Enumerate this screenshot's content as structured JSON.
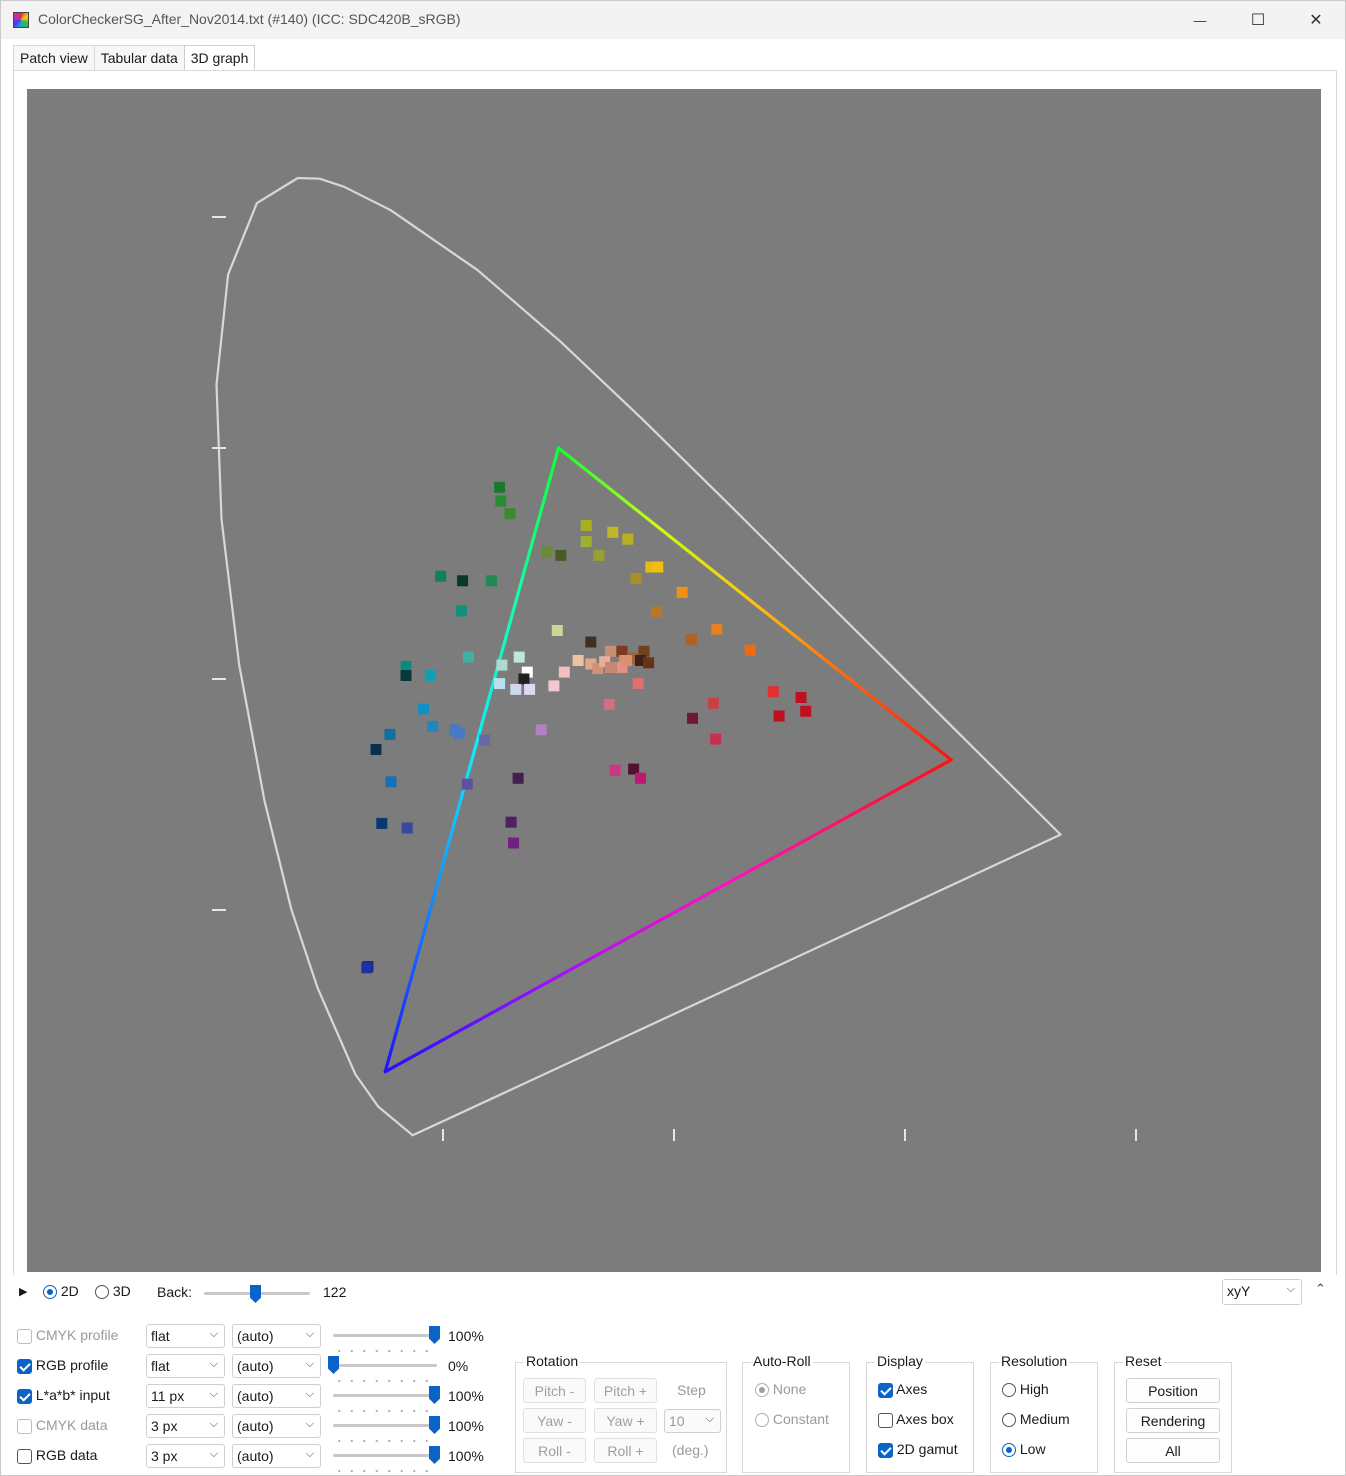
{
  "window": {
    "title": "ColorCheckerSG_After_Nov2014.txt (#140) (ICC: SDC420B_sRGB)",
    "minimize": "—",
    "maximize": "☐",
    "close": "✕"
  },
  "tabs": [
    {
      "label": "Patch view",
      "active": false
    },
    {
      "label": "Tabular data",
      "active": false
    },
    {
      "label": "3D graph",
      "active": true
    }
  ],
  "view": {
    "mode_2d": "2D",
    "mode_3d": "3D",
    "selected_mode": "2D",
    "back_label": "Back:",
    "back_value": "122",
    "back_level": 0.48,
    "colorspace": "xyY",
    "expand_icon": "double-chevron-up-icon"
  },
  "layers": [
    {
      "label": "CMYK profile",
      "checked": false,
      "enabled": false,
      "style": "flat",
      "color": "(auto)",
      "opacity_pct": "100%",
      "opacity": 1.0
    },
    {
      "label": "RGB profile",
      "checked": true,
      "enabled": true,
      "style": "flat",
      "color": "(auto)",
      "opacity_pct": "0%",
      "opacity": 0.0
    },
    {
      "label": "L*a*b* input",
      "checked": true,
      "enabled": true,
      "style": "11 px",
      "color": "(auto)",
      "opacity_pct": "100%",
      "opacity": 1.0
    },
    {
      "label": "CMYK data",
      "checked": false,
      "enabled": false,
      "style": "3 px",
      "color": "(auto)",
      "opacity_pct": "100%",
      "opacity": 1.0
    },
    {
      "label": "RGB data",
      "checked": false,
      "enabled": true,
      "style": "3 px",
      "color": "(auto)",
      "opacity_pct": "100%",
      "opacity": 1.0
    }
  ],
  "rotation": {
    "title": "Rotation",
    "pitch_minus": "Pitch -",
    "pitch_plus": "Pitch +",
    "yaw_minus": "Yaw -",
    "yaw_plus": "Yaw +",
    "roll_minus": "Roll -",
    "roll_plus": "Roll +",
    "step_label": "Step",
    "step_value": "10",
    "unit": "(deg.)"
  },
  "auto_roll": {
    "title": "Auto-Roll",
    "options": [
      "None",
      "Constant"
    ],
    "selected": "None"
  },
  "display": {
    "title": "Display",
    "axes": {
      "label": "Axes",
      "checked": true
    },
    "axes_box": {
      "label": "Axes box",
      "checked": false
    },
    "gamut_2d": {
      "label": "2D gamut",
      "checked": true
    }
  },
  "resolution": {
    "title": "Resolution",
    "options": [
      "High",
      "Medium",
      "Low"
    ],
    "selected": "Low"
  },
  "reset": {
    "title": "Reset",
    "position": "Position",
    "rendering": "Rendering",
    "all": "All"
  },
  "chart_data": {
    "type": "scatter",
    "colorspace": "xyY",
    "x_axis_color": "#d01010",
    "y_axis_color": "#20c020",
    "xlim": [
      0,
      0.8
    ],
    "ylim": [
      0,
      0.8
    ],
    "x_ticks": [
      0.2,
      0.4,
      0.6,
      0.8
    ],
    "y_ticks": [
      0.2,
      0.4,
      0.6,
      0.8
    ],
    "spectral_locus": [
      [
        0.1738,
        0.0049
      ],
      [
        0.144,
        0.0297
      ],
      [
        0.1241,
        0.0578
      ],
      [
        0.0913,
        0.1327
      ],
      [
        0.0687,
        0.2007
      ],
      [
        0.0454,
        0.295
      ],
      [
        0.0235,
        0.4127
      ],
      [
        0.0082,
        0.5384
      ],
      [
        0.0039,
        0.6548
      ],
      [
        0.0139,
        0.7502
      ],
      [
        0.0389,
        0.812
      ],
      [
        0.0743,
        0.8338
      ],
      [
        0.0932,
        0.8332
      ],
      [
        0.1142,
        0.8262
      ],
      [
        0.1547,
        0.8059
      ],
      [
        0.2296,
        0.7543
      ],
      [
        0.3016,
        0.6923
      ],
      [
        0.3731,
        0.6245
      ],
      [
        0.4441,
        0.5547
      ],
      [
        0.5125,
        0.4866
      ],
      [
        0.5752,
        0.4242
      ],
      [
        0.627,
        0.3725
      ],
      [
        0.6915,
        0.3083
      ],
      [
        0.7347,
        0.2653
      ]
    ],
    "srgb_gamut": {
      "red": [
        0.64,
        0.33
      ],
      "green": [
        0.3,
        0.6
      ],
      "blue": [
        0.15,
        0.06
      ]
    },
    "patches": [
      {
        "x": 0.249,
        "y": 0.566,
        "c": "#1a7a2a"
      },
      {
        "x": 0.25,
        "y": 0.554,
        "c": "#2a8a30"
      },
      {
        "x": 0.258,
        "y": 0.543,
        "c": "#3a8a30"
      },
      {
        "x": 0.324,
        "y": 0.533,
        "c": "#a8b020"
      },
      {
        "x": 0.324,
        "y": 0.519,
        "c": "#a0b030"
      },
      {
        "x": 0.347,
        "y": 0.527,
        "c": "#c0b828"
      },
      {
        "x": 0.36,
        "y": 0.521,
        "c": "#b8b020"
      },
      {
        "x": 0.335,
        "y": 0.507,
        "c": "#98a030"
      },
      {
        "x": 0.29,
        "y": 0.51,
        "c": "#6a8a38"
      },
      {
        "x": 0.302,
        "y": 0.507,
        "c": "#4a5a28"
      },
      {
        "x": 0.38,
        "y": 0.497,
        "c": "#e8b818"
      },
      {
        "x": 0.386,
        "y": 0.497,
        "c": "#f0c010"
      },
      {
        "x": 0.367,
        "y": 0.487,
        "c": "#a89028"
      },
      {
        "x": 0.407,
        "y": 0.475,
        "c": "#f09018"
      },
      {
        "x": 0.385,
        "y": 0.458,
        "c": "#b87828"
      },
      {
        "x": 0.437,
        "y": 0.443,
        "c": "#e88020"
      },
      {
        "x": 0.466,
        "y": 0.425,
        "c": "#f06a10"
      },
      {
        "x": 0.415,
        "y": 0.434,
        "c": "#b06020"
      },
      {
        "x": 0.198,
        "y": 0.489,
        "c": "#108060"
      },
      {
        "x": 0.217,
        "y": 0.485,
        "c": "#083828"
      },
      {
        "x": 0.242,
        "y": 0.485,
        "c": "#208a50"
      },
      {
        "x": 0.216,
        "y": 0.459,
        "c": "#10907a"
      },
      {
        "x": 0.222,
        "y": 0.419,
        "c": "#40b0a0"
      },
      {
        "x": 0.168,
        "y": 0.411,
        "c": "#108880"
      },
      {
        "x": 0.168,
        "y": 0.403,
        "c": "#083838"
      },
      {
        "x": 0.189,
        "y": 0.403,
        "c": "#10a0b0"
      },
      {
        "x": 0.251,
        "y": 0.412,
        "c": "#b0d8d0"
      },
      {
        "x": 0.266,
        "y": 0.419,
        "c": "#c0e8d8"
      },
      {
        "x": 0.299,
        "y": 0.442,
        "c": "#c8d898"
      },
      {
        "x": 0.328,
        "y": 0.432,
        "c": "#403020"
      },
      {
        "x": 0.345,
        "y": 0.424,
        "c": "#c89070"
      },
      {
        "x": 0.355,
        "y": 0.424,
        "c": "#803820"
      },
      {
        "x": 0.357,
        "y": 0.416,
        "c": "#c89070"
      },
      {
        "x": 0.365,
        "y": 0.418,
        "c": "#a06030"
      },
      {
        "x": 0.374,
        "y": 0.424,
        "c": "#704020"
      },
      {
        "x": 0.371,
        "y": 0.416,
        "c": "#402018"
      },
      {
        "x": 0.378,
        "y": 0.414,
        "c": "#6a3018"
      },
      {
        "x": 0.317,
        "y": 0.416,
        "c": "#f0c0a0"
      },
      {
        "x": 0.328,
        "y": 0.413,
        "c": "#e0a888"
      },
      {
        "x": 0.334,
        "y": 0.409,
        "c": "#d09078"
      },
      {
        "x": 0.34,
        "y": 0.415,
        "c": "#e8b098"
      },
      {
        "x": 0.345,
        "y": 0.41,
        "c": "#c88870"
      },
      {
        "x": 0.355,
        "y": 0.41,
        "c": "#e89080"
      },
      {
        "x": 0.359,
        "y": 0.416,
        "c": "#d89070"
      },
      {
        "x": 0.273,
        "y": 0.406,
        "c": "#ffffff"
      },
      {
        "x": 0.27,
        "y": 0.4,
        "c": "#202020"
      },
      {
        "x": 0.305,
        "y": 0.406,
        "c": "#f0c0c0"
      },
      {
        "x": 0.296,
        "y": 0.394,
        "c": "#f0c8d0"
      },
      {
        "x": 0.249,
        "y": 0.396,
        "c": "#b8e0f0"
      },
      {
        "x": 0.263,
        "y": 0.391,
        "c": "#d0d8f0"
      },
      {
        "x": 0.275,
        "y": 0.391,
        "c": "#e0d8f0"
      },
      {
        "x": 0.369,
        "y": 0.396,
        "c": "#e07070"
      },
      {
        "x": 0.344,
        "y": 0.378,
        "c": "#d07080"
      },
      {
        "x": 0.434,
        "y": 0.379,
        "c": "#c84048"
      },
      {
        "x": 0.416,
        "y": 0.366,
        "c": "#701830"
      },
      {
        "x": 0.486,
        "y": 0.389,
        "c": "#e03030"
      },
      {
        "x": 0.51,
        "y": 0.384,
        "c": "#c01020"
      },
      {
        "x": 0.514,
        "y": 0.372,
        "c": "#c01020"
      },
      {
        "x": 0.491,
        "y": 0.368,
        "c": "#c01020"
      },
      {
        "x": 0.436,
        "y": 0.348,
        "c": "#c83050"
      },
      {
        "x": 0.183,
        "y": 0.374,
        "c": "#1090c0"
      },
      {
        "x": 0.191,
        "y": 0.359,
        "c": "#2088c0"
      },
      {
        "x": 0.21,
        "y": 0.356,
        "c": "#4878c0"
      },
      {
        "x": 0.214,
        "y": 0.353,
        "c": "#4878c8"
      },
      {
        "x": 0.236,
        "y": 0.347,
        "c": "#6868a8"
      },
      {
        "x": 0.285,
        "y": 0.356,
        "c": "#b080c0"
      },
      {
        "x": 0.154,
        "y": 0.352,
        "c": "#1070a0"
      },
      {
        "x": 0.142,
        "y": 0.339,
        "c": "#083050"
      },
      {
        "x": 0.349,
        "y": 0.321,
        "c": "#c83880"
      },
      {
        "x": 0.365,
        "y": 0.322,
        "c": "#501030"
      },
      {
        "x": 0.371,
        "y": 0.314,
        "c": "#c01870"
      },
      {
        "x": 0.155,
        "y": 0.311,
        "c": "#1870b8"
      },
      {
        "x": 0.221,
        "y": 0.309,
        "c": "#6050a0"
      },
      {
        "x": 0.265,
        "y": 0.314,
        "c": "#402050"
      },
      {
        "x": 0.147,
        "y": 0.275,
        "c": "#083870"
      },
      {
        "x": 0.169,
        "y": 0.271,
        "c": "#3848a0"
      },
      {
        "x": 0.259,
        "y": 0.276,
        "c": "#502060"
      },
      {
        "x": 0.261,
        "y": 0.258,
        "c": "#702080"
      },
      {
        "x": 0.135,
        "y": 0.151,
        "c": "#102880"
      },
      {
        "x": 0.134,
        "y": 0.15,
        "c": "#2030a0"
      }
    ]
  }
}
